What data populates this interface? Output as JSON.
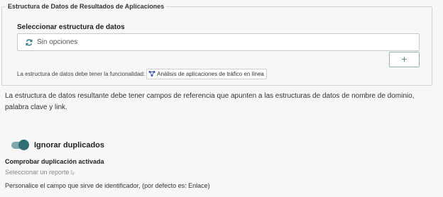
{
  "section": {
    "legend": "Estructura de Datos de Resultados de Aplicaciones",
    "select_label": "Seleccionar estructura de datos",
    "select_value": "Sin opciones",
    "refresh_icon": "refresh-icon",
    "add_button_label": "+",
    "requirement_text": "La estructura de datos debe tener la funcionalidad:",
    "functionality_tag": "Análisis de aplicaciones de tráfico en línea",
    "functionality_icon": "network-icon"
  },
  "description": "La estructura de datos resultante debe tener campos de referencia que apunten a las estructuras de datos de nombre de dominio, palabra clave y link.",
  "ignore_duplicates": {
    "label": "Ignorar duplicados",
    "enabled": true,
    "accent_color": "#2f6e75"
  },
  "duplicate_check": {
    "title": "Comprobar duplicación activada",
    "select_report": "Seleccionar un reporte",
    "identifier_text": "Personalice el campo que sirve de identificador, (por defecto es: Enlace)"
  }
}
